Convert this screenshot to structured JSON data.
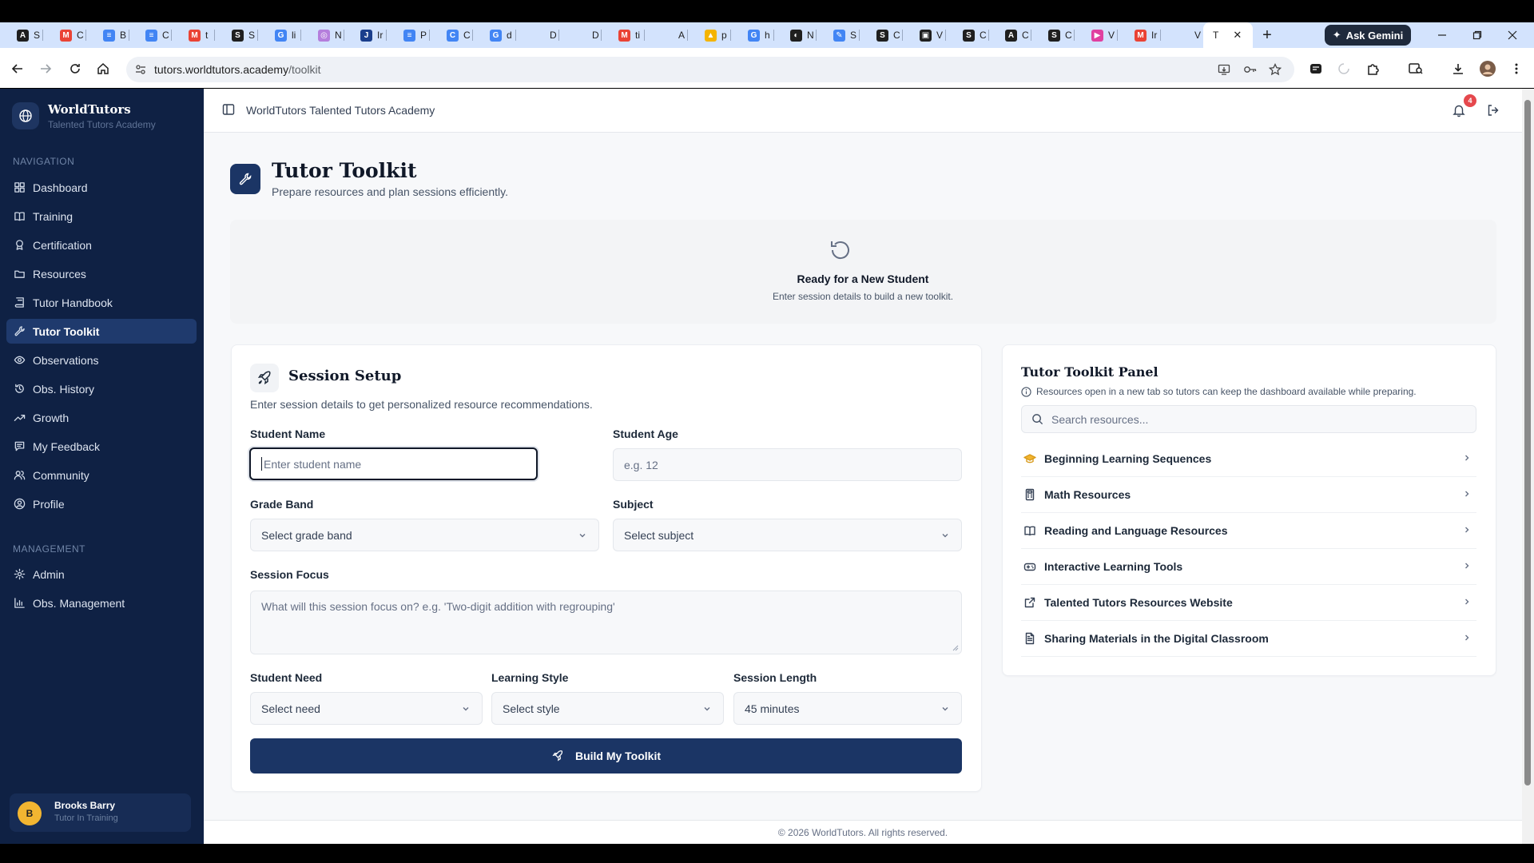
{
  "browser": {
    "tabs": [
      {
        "label": "S",
        "color": "#1f1f1f",
        "glyph": "A"
      },
      {
        "label": "C",
        "color": "#ea4335",
        "glyph": "M"
      },
      {
        "label": "B",
        "color": "#4285f4",
        "glyph": "≡"
      },
      {
        "label": "C",
        "color": "#4285f4",
        "glyph": "≡"
      },
      {
        "label": "t",
        "color": "#ea4335",
        "glyph": "M"
      },
      {
        "label": "S",
        "color": "#1f1f1f",
        "glyph": "S"
      },
      {
        "label": "li",
        "color": "#4285f4",
        "glyph": "G"
      },
      {
        "label": "N",
        "color": "#b57edc",
        "glyph": "◎"
      },
      {
        "label": "Ir",
        "color": "#1a3e8c",
        "glyph": "J"
      },
      {
        "label": "P",
        "color": "#4285f4",
        "glyph": "≡"
      },
      {
        "label": "C",
        "color": "#4285f4",
        "glyph": "C"
      },
      {
        "label": "d",
        "color": "#4285f4",
        "glyph": "G"
      },
      {
        "label": "D",
        "color": "#9aa9c2",
        "glyph": ""
      },
      {
        "label": "D",
        "color": "#9aa9c2",
        "glyph": ""
      },
      {
        "label": "ti",
        "color": "#ea4335",
        "glyph": "M"
      },
      {
        "label": "A",
        "color": "#9aa9c2",
        "glyph": ""
      },
      {
        "label": "p",
        "color": "#f4b400",
        "glyph": "▲"
      },
      {
        "label": "h",
        "color": "#4285f4",
        "glyph": "G"
      },
      {
        "label": "N",
        "color": "#1f1f1f",
        "glyph": "◐"
      },
      {
        "label": "S",
        "color": "#4285f4",
        "glyph": "✎"
      },
      {
        "label": "C",
        "color": "#1f1f1f",
        "glyph": "S"
      },
      {
        "label": "V",
        "color": "#1f1f1f",
        "glyph": "▣"
      },
      {
        "label": "C",
        "color": "#1f1f1f",
        "glyph": "S"
      },
      {
        "label": "C",
        "color": "#1f1f1f",
        "glyph": "A"
      },
      {
        "label": "C",
        "color": "#1f1f1f",
        "glyph": "S"
      },
      {
        "label": "V",
        "color": "#e040a0",
        "glyph": "▶"
      },
      {
        "label": "Ir",
        "color": "#ea4335",
        "glyph": "M"
      },
      {
        "label": "V",
        "color": "#9aa9c2",
        "glyph": ""
      }
    ],
    "active_tab": {
      "label": "T",
      "close": "✕"
    },
    "new_tab": "+",
    "ask_gemini": "Ask Gemini",
    "url_host": "tutors.worldtutors.academy",
    "url_path": "/toolkit"
  },
  "brand": {
    "name": "WorldTutors",
    "tagline": "Talented Tutors Academy"
  },
  "nav": {
    "heading": "NAVIGATION",
    "items": [
      {
        "label": "Dashboard",
        "icon": "grid-icon"
      },
      {
        "label": "Training",
        "icon": "book-icon"
      },
      {
        "label": "Certification",
        "icon": "award-icon"
      },
      {
        "label": "Resources",
        "icon": "folder-icon"
      },
      {
        "label": "Tutor Handbook",
        "icon": "handbook-icon"
      },
      {
        "label": "Tutor Toolkit",
        "icon": "wrench-icon",
        "active": true
      },
      {
        "label": "Observations",
        "icon": "eye-icon"
      },
      {
        "label": "Obs. History",
        "icon": "history-icon"
      },
      {
        "label": "Growth",
        "icon": "trend-icon"
      },
      {
        "label": "My Feedback",
        "icon": "message-icon"
      },
      {
        "label": "Community",
        "icon": "users-icon"
      },
      {
        "label": "Profile",
        "icon": "user-circle-icon"
      }
    ]
  },
  "management": {
    "heading": "MANAGEMENT",
    "items": [
      {
        "label": "Admin",
        "icon": "gear-icon"
      },
      {
        "label": "Obs. Management",
        "icon": "bar-chart-icon"
      }
    ]
  },
  "user": {
    "initial": "B",
    "name": "Brooks Barry",
    "role": "Tutor In Training"
  },
  "header": {
    "title": "WorldTutors Talented Tutors Academy",
    "notifications": "4"
  },
  "page": {
    "title": "Tutor Toolkit",
    "subtitle": "Prepare resources and plan sessions efficiently."
  },
  "ready": {
    "title": "Ready for a New Student",
    "subtitle": "Enter session details to build a new toolkit."
  },
  "setup": {
    "title": "Session Setup",
    "description": "Enter session details to get personalized resource recommendations.",
    "student_name": {
      "label": "Student Name",
      "placeholder": "Enter student name"
    },
    "student_age": {
      "label": "Student Age",
      "placeholder": "e.g. 12"
    },
    "grade_band": {
      "label": "Grade Band",
      "value": "Select grade band"
    },
    "subject": {
      "label": "Subject",
      "value": "Select subject"
    },
    "focus": {
      "label": "Session Focus",
      "placeholder": "What will this session focus on? e.g. 'Two-digit addition with regrouping'"
    },
    "need": {
      "label": "Student Need",
      "value": "Select need"
    },
    "style": {
      "label": "Learning Style",
      "value": "Select style"
    },
    "length": {
      "label": "Session Length",
      "value": "45 minutes"
    },
    "build": "Build My Toolkit"
  },
  "toolkit": {
    "title": "Tutor Toolkit Panel",
    "note": "Resources open in a new tab so tutors can keep the dashboard available while preparing.",
    "search_placeholder": "Search resources...",
    "items": [
      {
        "label": "Beginning Learning Sequences",
        "icon": "graduation-cap-icon"
      },
      {
        "label": "Math Resources",
        "icon": "calculator-icon"
      },
      {
        "label": "Reading and Language Resources",
        "icon": "open-book-icon"
      },
      {
        "label": "Interactive Learning Tools",
        "icon": "gamepad-icon"
      },
      {
        "label": "Talented Tutors Resources Website",
        "icon": "external-link-icon"
      },
      {
        "label": "Sharing Materials in the Digital Classroom",
        "icon": "document-icon"
      }
    ]
  },
  "footer": "© 2026 WorldTutors. All rights reserved.",
  "colors": {
    "sidebar": "#0f2144",
    "primary": "#1b3565",
    "badge": "#e5484d",
    "avatar": "#f2b531"
  }
}
